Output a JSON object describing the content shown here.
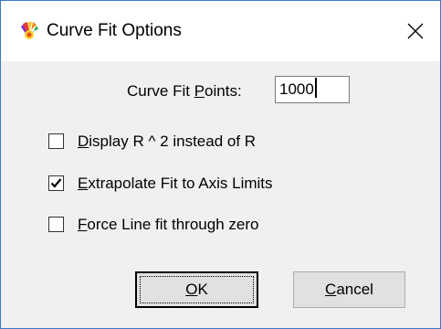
{
  "window": {
    "title": "Curve Fit Options",
    "app_icon": "colorful-flower-icon",
    "close_icon": "close-icon"
  },
  "points": {
    "label_prefix": "Curve Fit ",
    "label_accel": "P",
    "label_suffix": "oints:",
    "value": "1000"
  },
  "options": [
    {
      "accel": "D",
      "rest": "isplay R ^ 2 instead of R",
      "checked": false
    },
    {
      "accel": "E",
      "rest": "xtrapolate Fit to Axis Limits",
      "checked": true
    },
    {
      "accel": "F",
      "rest": "orce Line fit through zero",
      "checked": false
    }
  ],
  "buttons": {
    "ok_accel": "O",
    "ok_rest": "K",
    "cancel_accel": "C",
    "cancel_rest": "ancel"
  },
  "colors": {
    "window_border": "#3c78c8",
    "dialog_bg": "#f0f0f0",
    "button_bg": "#e1e1e1"
  }
}
